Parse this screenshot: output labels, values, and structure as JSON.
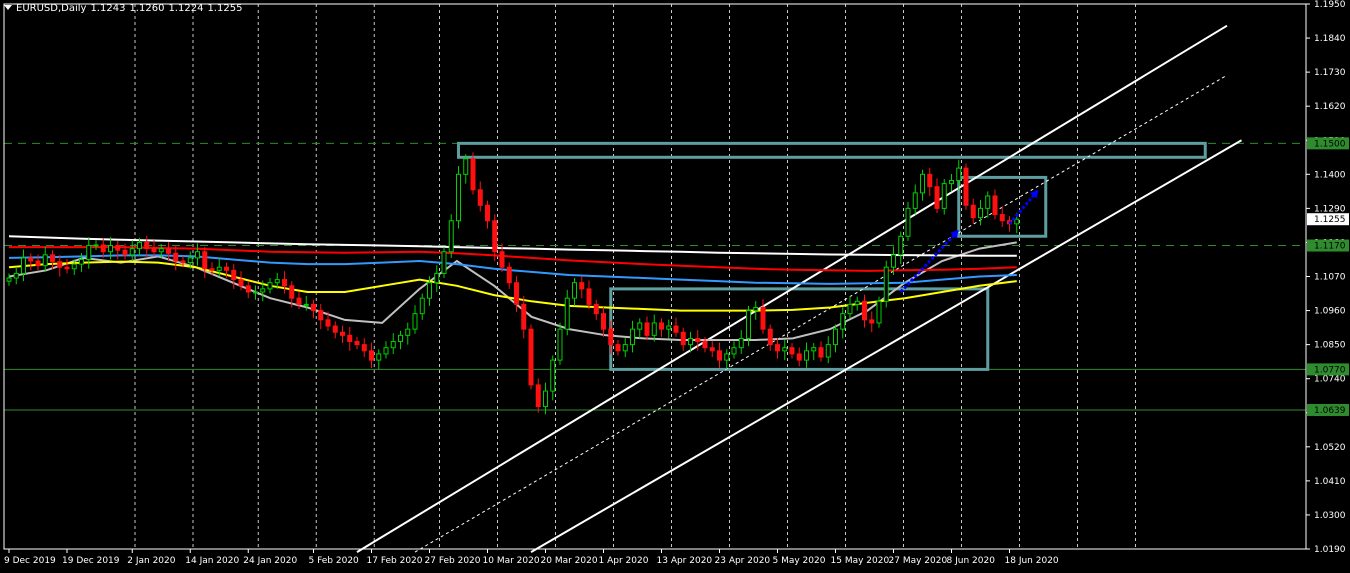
{
  "header": {
    "symbol": "EURUSD,Daily",
    "open": "1.1243",
    "high": "1.1260",
    "low": "1.1224",
    "close": "1.1255"
  },
  "chart_data": {
    "type": "candlestick",
    "symbol": "EURUSD",
    "timeframe": "Daily",
    "ylim": [
      1.019,
      1.195
    ],
    "y_ticks": [
      "1.1950",
      "1.1840",
      "1.1730",
      "1.1620",
      "1.1510",
      "1.1400",
      "1.1290",
      "1.1180",
      "1.1070",
      "1.0960",
      "1.0850",
      "1.0740",
      "1.0630",
      "1.0520",
      "1.0410",
      "1.0300",
      "1.0190"
    ],
    "x_ticks": [
      {
        "label": "9 Dec 2019",
        "index": 0
      },
      {
        "label": "19 Dec 2019",
        "index": 8
      },
      {
        "label": "2 Jan 2020",
        "index": 17
      },
      {
        "label": "14 Jan 2020",
        "index": 25
      },
      {
        "label": "24 Jan 2020",
        "index": 33
      },
      {
        "label": "5 Feb 2020",
        "index": 42
      },
      {
        "label": "17 Feb 2020",
        "index": 50
      },
      {
        "label": "27 Feb 2020",
        "index": 58
      },
      {
        "label": "10 Mar 2020",
        "index": 66
      },
      {
        "label": "20 Mar 2020",
        "index": 74
      },
      {
        "label": "1 Apr 2020",
        "index": 82
      },
      {
        "label": "13 Apr 2020",
        "index": 90
      },
      {
        "label": "23 Apr 2020",
        "index": 98
      },
      {
        "label": "5 May 2020",
        "index": 106
      },
      {
        "label": "15 May 2020",
        "index": 114
      },
      {
        "label": "27 May 2020",
        "index": 122
      },
      {
        "label": "8 Jun 2020",
        "index": 130
      },
      {
        "label": "18 Jun 2020",
        "index": 138
      }
    ],
    "horizontal_levels": [
      {
        "price": 1.15,
        "label": "1.1500",
        "style": "dashed",
        "color": "#2e8b2e"
      },
      {
        "price": 1.117,
        "label": "1.1170",
        "style": "dashed",
        "color": "#2e8b2e"
      },
      {
        "price": 1.077,
        "label": "1.0770",
        "style": "solid",
        "color": "#2e8b2e"
      },
      {
        "price": 1.0639,
        "label": "1.0639",
        "style": "solid",
        "color": "#2e8b2e"
      }
    ],
    "current_price": {
      "price": 1.1255,
      "label": "1.1255"
    },
    "closes": [
      1.1065,
      1.108,
      1.113,
      1.112,
      1.1105,
      1.114,
      1.1118,
      1.11,
      1.1095,
      1.111,
      1.1125,
      1.117,
      1.1172,
      1.115,
      1.117,
      1.1155,
      1.114,
      1.116,
      1.118,
      1.116,
      1.115,
      1.116,
      1.1145,
      1.112,
      1.1115,
      1.113,
      1.115,
      1.1095,
      1.109,
      1.11,
      1.109,
      1.106,
      1.104,
      1.102,
      1.102,
      1.103,
      1.105,
      1.106,
      1.104,
      1.1,
      1.098,
      1.098,
      1.096,
      1.093,
      1.091,
      1.089,
      1.088,
      1.086,
      1.085,
      1.083,
      1.08,
      1.082,
      1.084,
      1.086,
      1.088,
      1.09,
      1.095,
      1.1,
      1.105,
      1.108,
      1.115,
      1.125,
      1.14,
      1.145,
      1.135,
      1.13,
      1.125,
      1.115,
      1.11,
      1.105,
      1.098,
      1.09,
      1.072,
      1.065,
      1.07,
      1.08,
      1.09,
      1.1,
      1.105,
      1.103,
      1.098,
      1.095,
      1.09,
      1.085,
      1.083,
      1.085,
      1.09,
      1.092,
      1.088,
      1.092,
      1.09,
      1.091,
      1.089,
      1.085,
      1.087,
      1.086,
      1.084,
      1.083,
      1.08,
      1.082,
      1.084,
      1.087,
      1.096,
      1.097,
      1.09,
      1.085,
      1.083,
      1.084,
      1.082,
      1.08,
      1.083,
      1.084,
      1.081,
      1.085,
      1.09,
      1.095,
      1.098,
      1.099,
      1.093,
      1.092,
      1.099,
      1.11,
      1.114,
      1.12,
      1.129,
      1.134,
      1.14,
      1.136,
      1.129,
      1.137,
      1.138,
      1.142,
      1.13,
      1.126,
      1.129,
      1.133,
      1.127,
      1.125,
      1.124,
      1.1255
    ],
    "moving_averages": [
      {
        "color": "#c0c0c0",
        "values": [
          1.107,
          1.109,
          1.113,
          1.1115,
          1.1135,
          1.11,
          1.105,
          1.1,
          1.097,
          1.093,
          1.092,
          1.103,
          1.112,
          1.104,
          1.094,
          1.09,
          1.088,
          1.087,
          1.0865,
          1.0865,
          1.0865,
          1.087,
          1.09,
          1.096,
          1.105,
          1.112,
          1.116,
          1.118
        ]
      },
      {
        "color": "#ffff00",
        "values": [
          1.11,
          1.111,
          1.1115,
          1.1118,
          1.1115,
          1.11,
          1.107,
          1.104,
          1.102,
          1.102,
          1.104,
          1.106,
          1.104,
          1.101,
          1.099,
          1.0975,
          1.097,
          1.0965,
          1.096,
          1.096,
          1.096,
          1.0962,
          1.097,
          1.0985,
          1.1,
          1.102,
          1.104,
          1.1055
        ]
      },
      {
        "color": "#3399ff",
        "values": [
          1.113,
          1.1132,
          1.1135,
          1.1138,
          1.1138,
          1.1135,
          1.1125,
          1.1115,
          1.111,
          1.111,
          1.1115,
          1.112,
          1.111,
          1.1095,
          1.1085,
          1.1075,
          1.107,
          1.1065,
          1.106,
          1.1055,
          1.105,
          1.1048,
          1.1046,
          1.1048,
          1.105,
          1.106,
          1.107,
          1.1075
        ]
      },
      {
        "color": "#ff0000",
        "values": [
          1.1165,
          1.1165,
          1.1165,
          1.1165,
          1.1162,
          1.116,
          1.1155,
          1.115,
          1.1148,
          1.1147,
          1.1148,
          1.115,
          1.1145,
          1.1138,
          1.113,
          1.1122,
          1.1116,
          1.111,
          1.1105,
          1.11,
          1.1095,
          1.1092,
          1.109,
          1.1088,
          1.109,
          1.1092,
          1.1095,
          1.11
        ]
      },
      {
        "color": "#ffffff",
        "values": [
          1.12,
          1.1196,
          1.1192,
          1.1189,
          1.1186,
          1.1183,
          1.118,
          1.1177,
          1.1174,
          1.1172,
          1.117,
          1.1168,
          1.1165,
          1.1162,
          1.116,
          1.1157,
          1.1155,
          1.1152,
          1.115,
          1.1147,
          1.1145,
          1.1143,
          1.1141,
          1.114,
          1.1139,
          1.1138,
          1.1137,
          1.1137
        ]
      }
    ],
    "channel_lines": [
      {
        "style": "solid",
        "from": {
          "index": 72,
          "price": 1.018
        },
        "to": {
          "index": 170,
          "price": 1.151
        }
      },
      {
        "style": "solid",
        "from": {
          "index": 48,
          "price": 1.018
        },
        "to": {
          "index": 168,
          "price": 1.188
        }
      },
      {
        "style": "dotted",
        "from": {
          "index": 56,
          "price": 1.018
        },
        "to": {
          "index": 168,
          "price": 1.172
        }
      }
    ],
    "rectangles": [
      {
        "color": "#5f9ea0",
        "from": {
          "index": 62,
          "price": 1.15
        },
        "to": {
          "index": 165,
          "price": 1.1455
        }
      },
      {
        "color": "#5f9ea0",
        "from": {
          "index": 83,
          "price": 1.103
        },
        "to": {
          "index": 135,
          "price": 1.077
        }
      },
      {
        "color": "#5f9ea0",
        "from": {
          "index": 131,
          "price": 1.139
        },
        "to": {
          "index": 143,
          "price": 1.12
        }
      }
    ],
    "arrows": [
      {
        "color": "#0000ff",
        "from": {
          "index": 123,
          "price": 1.102
        },
        "to": {
          "index": 131,
          "price": 1.122
        }
      },
      {
        "color": "#0000ff",
        "from": {
          "index": 138,
          "price": 1.124
        },
        "to": {
          "index": 142,
          "price": 1.135
        }
      }
    ]
  }
}
